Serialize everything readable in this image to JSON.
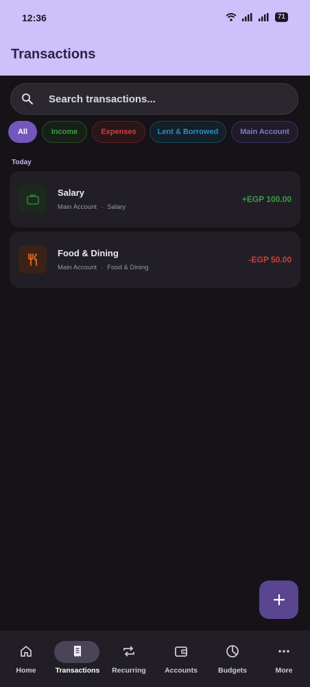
{
  "status_bar": {
    "time": "12:36",
    "battery": "71"
  },
  "header": {
    "title": "Transactions"
  },
  "search": {
    "placeholder": "Search transactions..."
  },
  "filters": [
    {
      "label": "All",
      "selected": true
    },
    {
      "label": "Income"
    },
    {
      "label": "Expenses"
    },
    {
      "label": "Lent & Borrowed"
    },
    {
      "label": "Main Account"
    }
  ],
  "sections": [
    {
      "label": "Today",
      "transactions": [
        {
          "title": "Salary",
          "account": "Main Account",
          "category": "Salary",
          "amount": "+EGP 100.00",
          "icon": "briefcase-icon",
          "color": "#3f9b45"
        },
        {
          "title": "Food & Dining",
          "account": "Main Account",
          "category": "Food & Dining",
          "amount": "-EGP 50.00",
          "icon": "fork-knife-icon",
          "color": "#d33d3d"
        }
      ]
    }
  ],
  "fab": {
    "icon": "plus-icon"
  },
  "bottom_nav": [
    {
      "label": "Home",
      "icon": "home-icon"
    },
    {
      "label": "Transactions",
      "icon": "receipt-icon",
      "active": true
    },
    {
      "label": "Recurring",
      "icon": "repeat-icon"
    },
    {
      "label": "Accounts",
      "icon": "wallet-icon"
    },
    {
      "label": "Budgets",
      "icon": "pie-chart-icon"
    },
    {
      "label": "More",
      "icon": "more-icon"
    }
  ],
  "colors": {
    "app_bar": "#cdc0fb",
    "background": "#151318",
    "accent": "#7357bd",
    "income": "#3f9b45",
    "expense": "#d33d3d",
    "lent": "#2f8cc6"
  }
}
